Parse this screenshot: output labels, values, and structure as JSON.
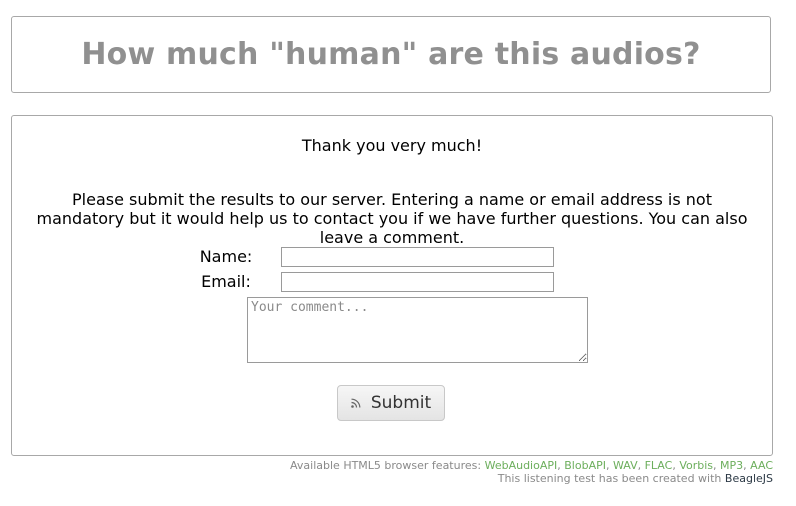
{
  "header": {
    "title": "How much \"human\" are this audios?"
  },
  "form": {
    "thanks": "Thank you very much!",
    "instructions": "Please submit the results to our server. Entering a name or email address is not mandatory but it would help us to contact you if we have further questions. You can also leave a comment.",
    "name_label": "Name:",
    "name_value": "",
    "email_label": "Email:",
    "email_value": "",
    "comment_placeholder": "Your comment...",
    "submit_label": "Submit",
    "submit_icon": "rss-icon"
  },
  "footer": {
    "features_prefix": "Available HTML5 browser features:",
    "features": [
      "WebAudioAPI",
      "BlobAPI",
      "WAV",
      "FLAC",
      "Vorbis",
      "MP3",
      "AAC"
    ],
    "credit_prefix": "This listening test has been created with",
    "credit_link": "BeagleJS"
  },
  "colors": {
    "title_gray": "#909090",
    "border": "#a8a8a8",
    "feature_green": "#6cae5c",
    "link_dark": "#2d3a46"
  }
}
